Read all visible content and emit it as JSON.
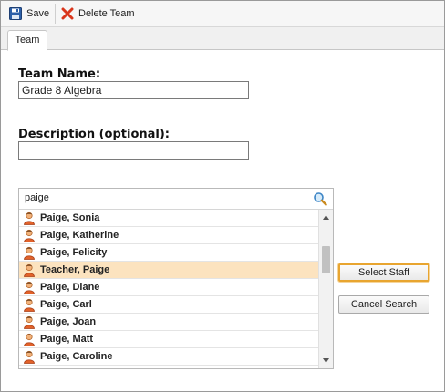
{
  "toolbar": {
    "save_label": "Save",
    "delete_label": "Delete Team"
  },
  "tabs": [
    {
      "label": "Team"
    }
  ],
  "form": {
    "team_name_label": "Team Name:",
    "team_name_value": "Grade 8 Algebra",
    "description_label": "Description (optional):",
    "description_value": ""
  },
  "staff_search": {
    "query": "paige",
    "results": [
      {
        "name": "Paige, Sonia"
      },
      {
        "name": "Paige, Katherine"
      },
      {
        "name": "Paige, Felicity"
      },
      {
        "name": "Teacher, Paige"
      },
      {
        "name": "Paige, Diane"
      },
      {
        "name": "Paige, Carl"
      },
      {
        "name": "Paige, Joan"
      },
      {
        "name": "Paige, Matt"
      },
      {
        "name": "Paige, Caroline"
      }
    ],
    "selected_name": "Teacher, Paige"
  },
  "buttons": {
    "select_staff": "Select Staff",
    "cancel_search": "Cancel Search"
  },
  "colors": {
    "selected_row": "#fce3bf",
    "focus_border": "#e8a530",
    "delete_icon": "#d9361c",
    "save_icon": "#2c5fa8"
  },
  "icons": {
    "save": "save-icon",
    "delete": "delete-icon",
    "search": "search-icon",
    "person": "person-icon"
  }
}
